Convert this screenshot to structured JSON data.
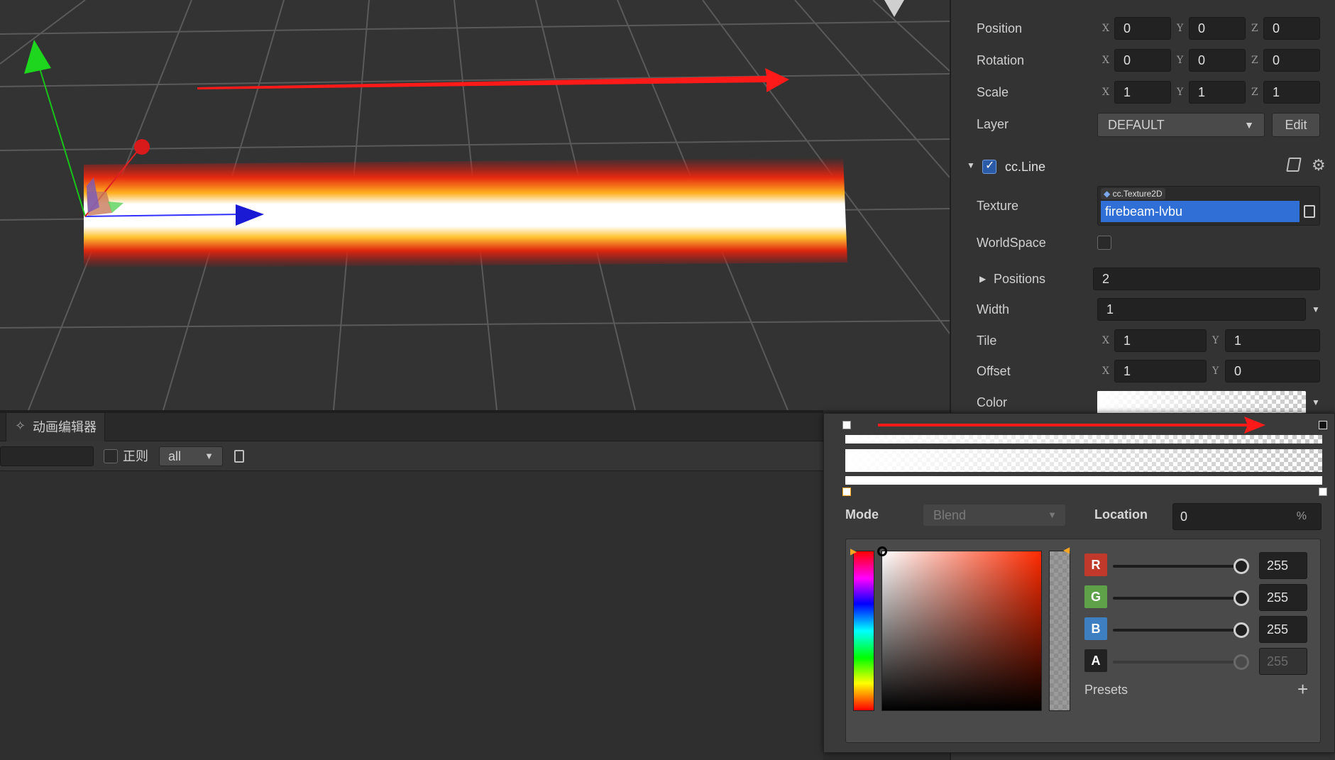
{
  "inspector": {
    "position": {
      "label": "Position",
      "x": "0",
      "y": "0",
      "z": "0"
    },
    "rotation": {
      "label": "Rotation",
      "x": "0",
      "y": "0",
      "z": "0"
    },
    "scale": {
      "label": "Scale",
      "x": "1",
      "y": "1",
      "z": "1"
    },
    "layer": {
      "label": "Layer",
      "value": "DEFAULT",
      "edit_label": "Edit"
    },
    "axis": {
      "x": "X",
      "y": "Y",
      "z": "Z"
    },
    "component": {
      "name": "cc.Line",
      "enabled": true,
      "texture": {
        "label": "Texture",
        "type_tag": "cc.Texture2D",
        "value": "firebeam-lvbu"
      },
      "worldspace": {
        "label": "WorldSpace",
        "checked": false
      },
      "positions": {
        "label": "Positions",
        "value": "2"
      },
      "width": {
        "label": "Width",
        "value": "1"
      },
      "tile": {
        "label": "Tile",
        "x": "1",
        "y": "1"
      },
      "offset": {
        "label": "Offset",
        "x": "1",
        "y": "0"
      },
      "color": {
        "label": "Color"
      }
    }
  },
  "animation_panel": {
    "tab_label": "动画编辑器",
    "regex_label": "正则",
    "filter_value": "all"
  },
  "gradient_editor": {
    "mode_label": "Mode",
    "mode_value": "Blend",
    "location_label": "Location",
    "location_value": "0",
    "location_unit": "%",
    "channels": [
      {
        "name": "R",
        "value": "255",
        "color": "#c0392b"
      },
      {
        "name": "G",
        "value": "255",
        "color": "#5fa148"
      },
      {
        "name": "B",
        "value": "255",
        "color": "#3d7fc1"
      },
      {
        "name": "A",
        "value": "255",
        "color": "#222222"
      }
    ],
    "presets_label": "Presets",
    "add_label": "+"
  },
  "colors": {
    "accent": "#2f6fd6",
    "annotation_arrow": "#ff1a1a"
  }
}
